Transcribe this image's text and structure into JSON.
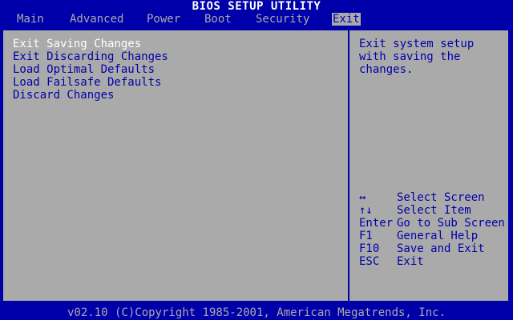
{
  "title": "BIOS SETUP UTILITY",
  "tabs": [
    "Main",
    "Advanced",
    "Power",
    "Boot",
    "Security",
    "Exit"
  ],
  "active_tab": "Exit",
  "options": [
    "Exit Saving Changes",
    "Exit Discarding Changes",
    "Load Optimal Defaults",
    "Load Failsafe Defaults",
    "Discard Changes"
  ],
  "selected_option": "Exit Saving Changes",
  "help_text": "Exit system setup with saving the changes.",
  "keys": [
    {
      "key": "↔",
      "desc": "Select Screen"
    },
    {
      "key": "↑↓",
      "desc": "Select Item"
    },
    {
      "key": "Enter",
      "desc": "Go to Sub Screen"
    },
    {
      "key": "F1",
      "desc": "General Help"
    },
    {
      "key": "F10",
      "desc": "Save and Exit"
    },
    {
      "key": "ESC",
      "desc": "Exit"
    }
  ],
  "footer": "v02.10 (C)Copyright 1985-2001, American Megatrends, Inc.",
  "colors": {
    "background": "#0000aa",
    "panel": "#aaaaaa",
    "highlight": "#ffffff"
  }
}
